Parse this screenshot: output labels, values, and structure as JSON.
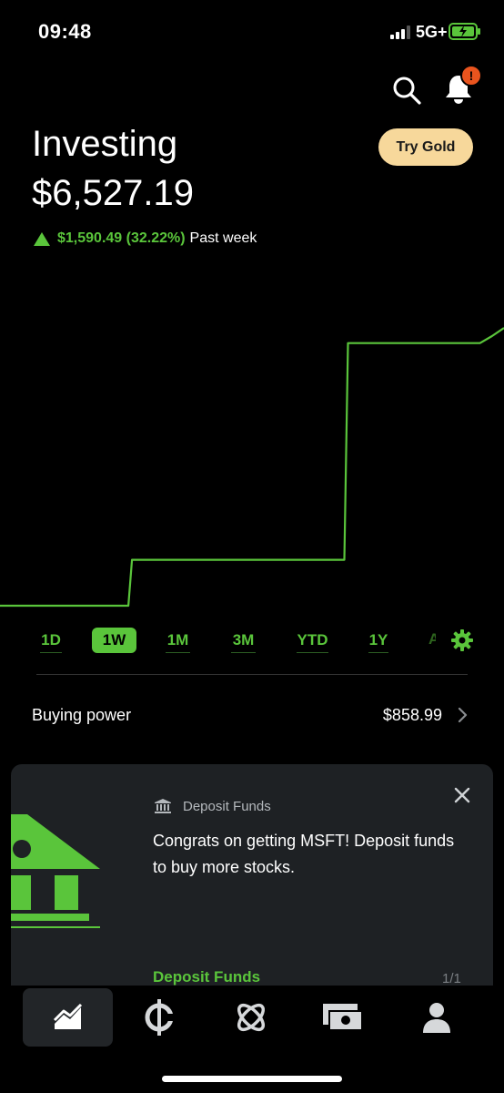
{
  "status_bar": {
    "time": "09:48",
    "network": "5G+"
  },
  "header": {
    "title": "Investing",
    "try_gold_label": "Try Gold",
    "notification_badge": "!"
  },
  "portfolio": {
    "value": "$6,527.19",
    "change": "$1,590.49 (32.22%)",
    "period": "Past week"
  },
  "colors": {
    "accent": "#5ac53b",
    "gold": "#f7d89b",
    "badge": "#e9541e",
    "card_bg": "#1e2124"
  },
  "chart_data": {
    "type": "line",
    "series": [
      {
        "values": [
          4937,
          4937,
          4937,
          4937,
          4937,
          4937,
          4937,
          4937,
          4937,
          4937,
          4937,
          5200,
          5200,
          5200,
          5200,
          5200,
          5200,
          5200,
          5200,
          5200,
          5200,
          5200,
          5200,
          5200,
          5200,
          5200,
          5200,
          5200,
          5200,
          6440,
          6440,
          6440,
          6440,
          6440,
          6440,
          6440,
          6440,
          6440,
          6440,
          6440,
          6440,
          6480,
          6527
        ]
      }
    ]
  },
  "time_ranges": [
    "1D",
    "1W",
    "1M",
    "3M",
    "YTD",
    "1Y",
    "ALL"
  ],
  "active_range": "1W",
  "buying_power": {
    "label": "Buying power",
    "value": "$858.99"
  },
  "promo_card": {
    "tag": "Deposit Funds",
    "body": "Congrats on getting MSFT! Deposit funds to buy more stocks.",
    "action": "Deposit Funds",
    "pager": "1/1"
  },
  "bottom_nav": [
    {
      "icon": "chart-icon",
      "active": true
    },
    {
      "icon": "crypto-icon",
      "active": false
    },
    {
      "icon": "explore-icon",
      "active": false
    },
    {
      "icon": "cash-icon",
      "active": false
    },
    {
      "icon": "profile-icon",
      "active": false
    }
  ]
}
